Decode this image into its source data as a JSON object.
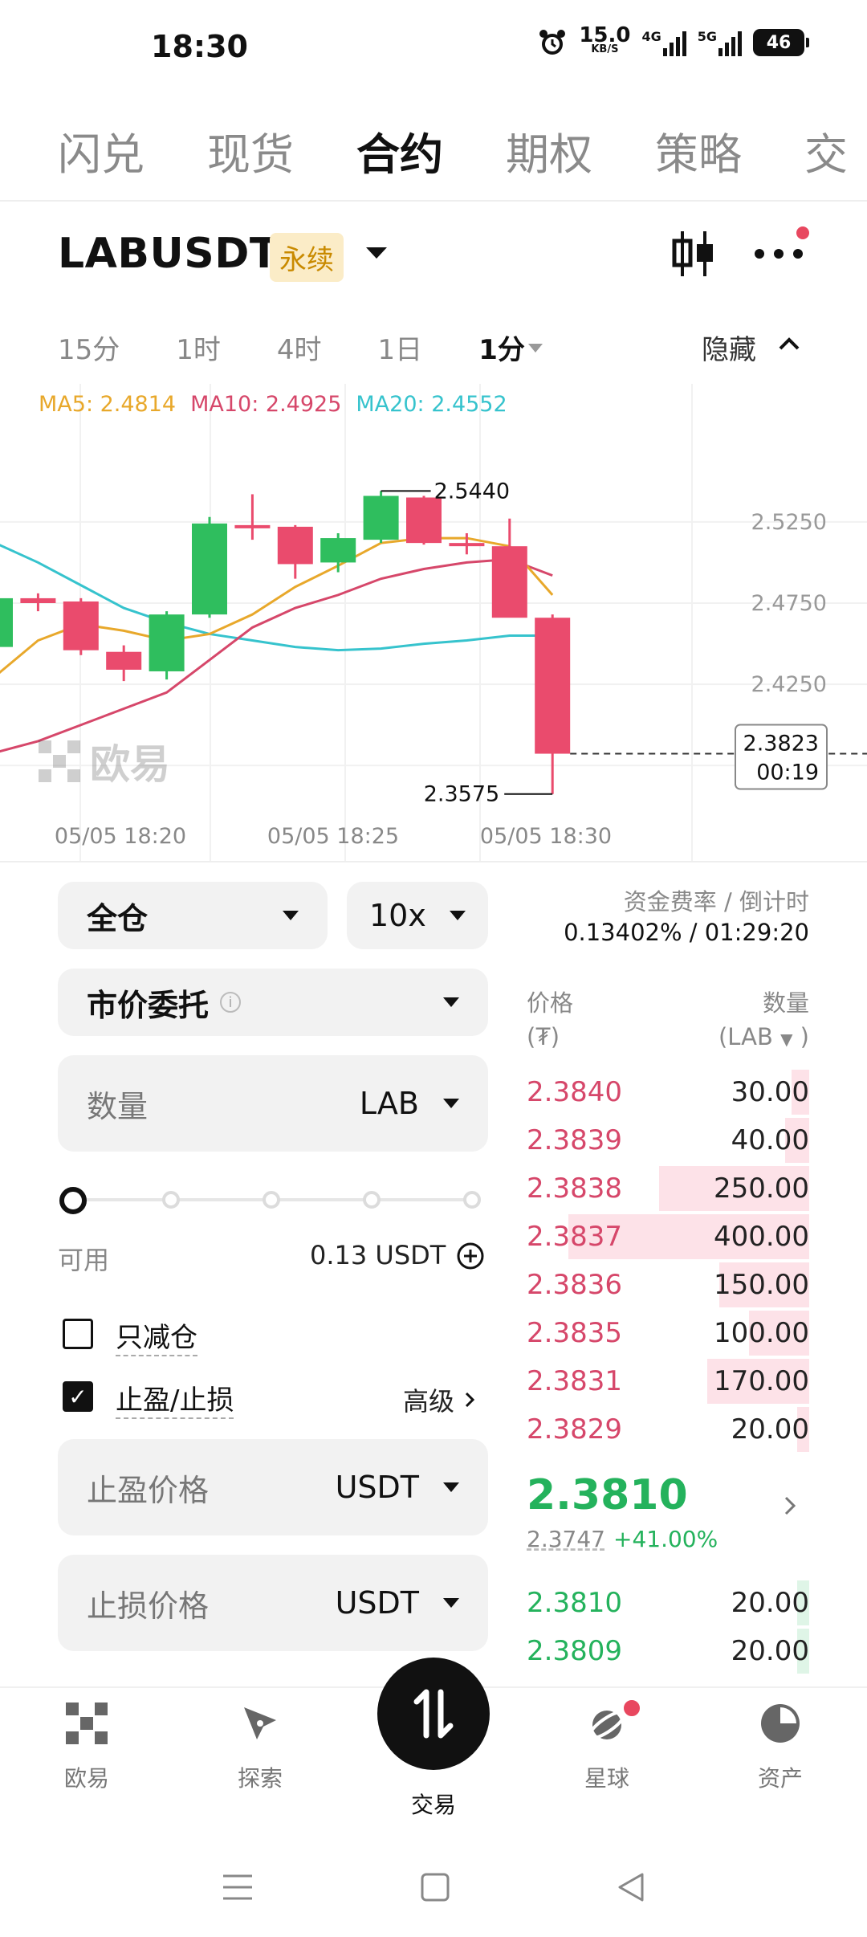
{
  "status_bar": {
    "time": "18:30",
    "net_speed": "15.0",
    "net_unit": "KB/S",
    "net1": "4G",
    "net2": "5G",
    "battery": "46"
  },
  "top_tabs": [
    "闪兑",
    "现货",
    "合约",
    "期权",
    "策略",
    "交"
  ],
  "active_top_tab": 2,
  "pair": {
    "symbol": "LABUSDT",
    "badge": "永续"
  },
  "timeframes": [
    "15分",
    "1时",
    "4时",
    "1日",
    "1分"
  ],
  "active_timeframe": 4,
  "hide_label": "隐藏",
  "ma_legend": {
    "ma5": "MA5: 2.4814",
    "ma10": "MA10: 2.4925",
    "ma20": "MA20: 2.4552"
  },
  "colors": {
    "ma5": "#e8a82b",
    "ma10": "#d6476a",
    "ma20": "#36c3cd",
    "up": "#2fbe5e",
    "down": "#ea4b6d"
  },
  "chart_data": {
    "type": "candlestick",
    "y_ticks": [
      "2.5250",
      "2.4750",
      "2.4250"
    ],
    "x_ticks": [
      "05/05 18:20",
      "05/05 18:25",
      "05/05 18:30"
    ],
    "high_label": "2.5440",
    "low_label": "2.3575",
    "last_price_label": "2.3823",
    "countdown_label": "00:19",
    "candles": [
      {
        "o": 2.448,
        "h": 2.48,
        "l": 2.44,
        "c": 2.478
      },
      {
        "o": 2.478,
        "h": 2.481,
        "l": 2.47,
        "c": 2.475
      },
      {
        "o": 2.476,
        "h": 2.478,
        "l": 2.443,
        "c": 2.446
      },
      {
        "o": 2.445,
        "h": 2.449,
        "l": 2.427,
        "c": 2.434
      },
      {
        "o": 2.433,
        "h": 2.47,
        "l": 2.428,
        "c": 2.468
      },
      {
        "o": 2.468,
        "h": 2.528,
        "l": 2.466,
        "c": 2.524
      },
      {
        "o": 2.523,
        "h": 2.542,
        "l": 2.514,
        "c": 2.522
      },
      {
        "o": 2.522,
        "h": 2.523,
        "l": 2.49,
        "c": 2.499
      },
      {
        "o": 2.5,
        "h": 2.518,
        "l": 2.494,
        "c": 2.515
      },
      {
        "o": 2.514,
        "h": 2.544,
        "l": 2.512,
        "c": 2.541
      },
      {
        "o": 2.54,
        "h": 2.541,
        "l": 2.511,
        "c": 2.512
      },
      {
        "o": 2.512,
        "h": 2.518,
        "l": 2.505,
        "c": 2.511
      },
      {
        "o": 2.51,
        "h": 2.527,
        "l": 2.468,
        "c": 2.466
      },
      {
        "o": 2.466,
        "h": 2.468,
        "l": 2.3575,
        "c": 2.3823
      }
    ],
    "ma5": [
      2.43,
      2.452,
      2.462,
      2.458,
      2.452,
      2.456,
      2.468,
      2.485,
      2.498,
      2.512,
      2.515,
      2.515,
      2.51,
      2.48
    ],
    "ma10": [
      2.383,
      2.39,
      2.4,
      2.41,
      2.42,
      2.44,
      2.46,
      2.472,
      2.48,
      2.49,
      2.496,
      2.5,
      2.502,
      2.492
    ],
    "ma20": [
      2.512,
      2.5,
      2.486,
      2.472,
      2.463,
      2.456,
      2.452,
      2.448,
      2.446,
      2.447,
      2.45,
      2.452,
      2.455,
      2.455
    ]
  },
  "watermark": "欧易",
  "margin_mode": "全仓",
  "leverage": "10x",
  "order_type": "市价委托",
  "qty": {
    "label": "数量",
    "unit": "LAB"
  },
  "available": {
    "label": "可用",
    "value": "0.13 USDT"
  },
  "reduce_only": "只减仓",
  "tp_sl": "止盈/止损",
  "advanced": "高级",
  "tp_price": {
    "label": "止盈价格",
    "unit": "USDT"
  },
  "sl_price": {
    "label": "止损价格",
    "unit": "USDT"
  },
  "funding": {
    "label": "资金费率 / 倒计时",
    "value": "0.13402% / 01:29:20"
  },
  "orderbook": {
    "price_header": "价格",
    "price_sub": "(₮)",
    "qty_header": "数量",
    "qty_sub": "(LAB",
    "asks": [
      {
        "p": "2.3840",
        "q": "30.00",
        "depth": 0.03
      },
      {
        "p": "2.3839",
        "q": "40.00",
        "depth": 0.04
      },
      {
        "p": "2.3838",
        "q": "250.00",
        "depth": 0.25
      },
      {
        "p": "2.3837",
        "q": "400.00",
        "depth": 0.4
      },
      {
        "p": "2.3836",
        "q": "150.00",
        "depth": 0.15
      },
      {
        "p": "2.3835",
        "q": "100.00",
        "depth": 0.1
      },
      {
        "p": "2.3831",
        "q": "170.00",
        "depth": 0.17
      },
      {
        "p": "2.3829",
        "q": "20.00",
        "depth": 0.02
      }
    ],
    "last_price": "2.3810",
    "mark_price": "2.3747",
    "change": "+41.00%",
    "bids": [
      {
        "p": "2.3810",
        "q": "20.00",
        "depth": 0.02
      },
      {
        "p": "2.3809",
        "q": "20.00",
        "depth": 0.02
      }
    ]
  },
  "bottom_nav": [
    "欧易",
    "探索",
    "交易",
    "星球",
    "资产"
  ]
}
